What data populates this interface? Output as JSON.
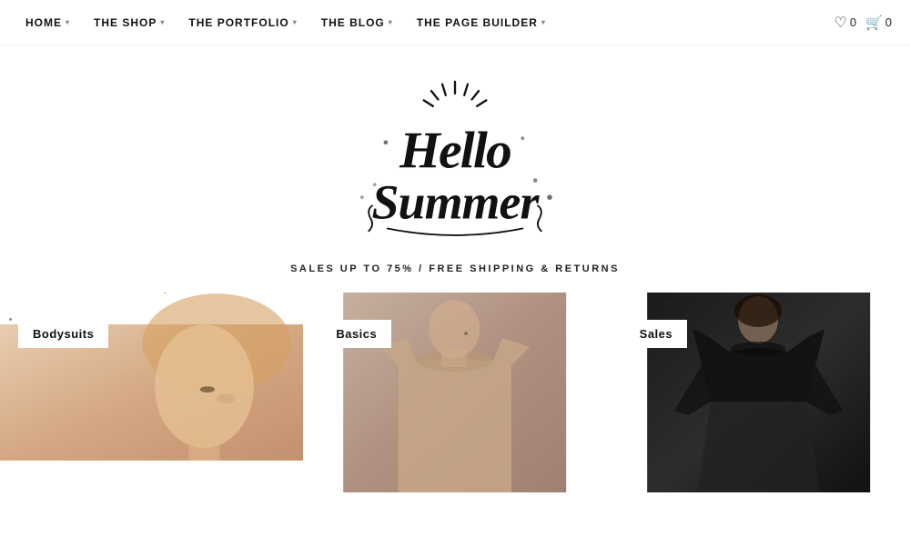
{
  "nav": {
    "items": [
      {
        "label": "HOME",
        "hasChevron": true
      },
      {
        "label": "THE SHOP",
        "hasChevron": true
      },
      {
        "label": "THE PORTFOLIO",
        "hasChevron": true
      },
      {
        "label": "THE BLOG",
        "hasChevron": true
      },
      {
        "label": "THE PAGE BUILDER",
        "hasChevron": true
      }
    ],
    "wishlist_count": "0",
    "cart_count": "0"
  },
  "hero": {
    "tagline": "SALES UP TO 75% / FREE SHIPPING & RETURNS"
  },
  "products": [
    {
      "label": "Bodysuits",
      "type": "bodysuits"
    },
    {
      "label": "Basics",
      "type": "basics"
    },
    {
      "label": "Sales",
      "type": "sales"
    }
  ],
  "icons": {
    "heart": "♡",
    "cart": "⊡",
    "chevron": "▾"
  }
}
